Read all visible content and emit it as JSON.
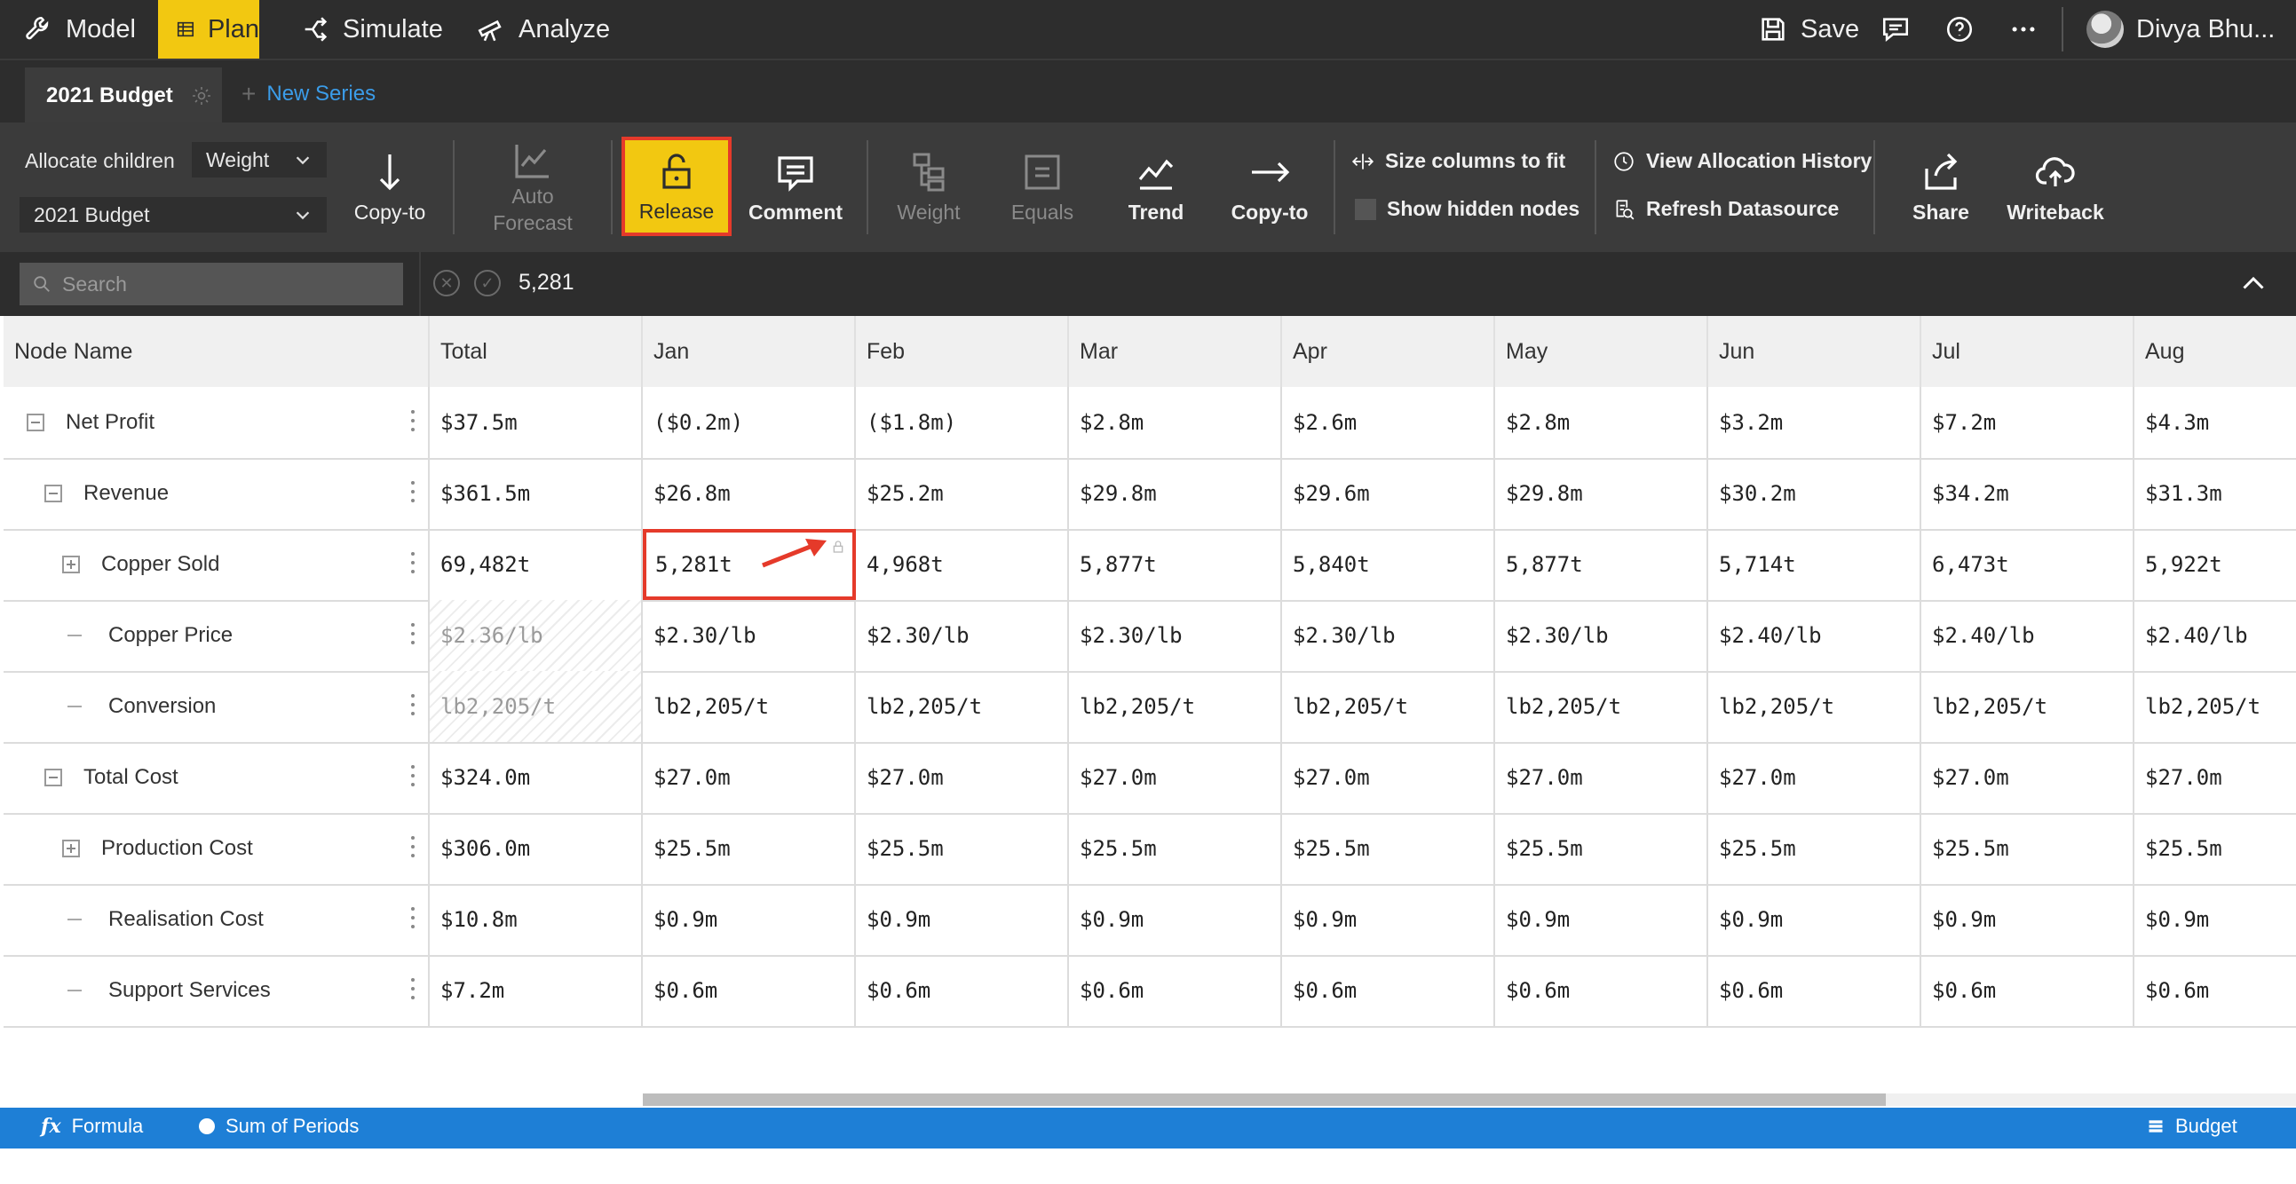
{
  "nav": {
    "model": "Model",
    "plan": "Plan",
    "simulate": "Simulate",
    "analyze": "Analyze",
    "save": "Save",
    "user": "Divya Bhu..."
  },
  "tabs": {
    "active": "2021 Budget",
    "new_series": "New Series"
  },
  "ribbon": {
    "allocate_children": "Allocate children",
    "weight_dropdown": "Weight",
    "series_dropdown": "2021 Budget",
    "copy_to_1": "Copy-to",
    "auto_forecast_1": "Auto",
    "auto_forecast_2": "Forecast",
    "release": "Release",
    "comment": "Comment",
    "weight": "Weight",
    "equals": "Equals",
    "trend": "Trend",
    "copy_to_2": "Copy-to",
    "size_columns": "Size columns to fit",
    "show_hidden": "Show hidden nodes",
    "view_history": "View Allocation History",
    "refresh": "Refresh Datasource",
    "share": "Share",
    "writeback": "Writeback"
  },
  "search": {
    "placeholder": "Search",
    "formula_value": "5,281"
  },
  "grid": {
    "headers": [
      "Node Name",
      "Total",
      "Jan",
      "Feb",
      "Mar",
      "Apr",
      "May",
      "Jun",
      "Jul",
      "Aug"
    ],
    "rows": [
      {
        "name": "Net Profit",
        "values": [
          "$37.5m",
          "($0.2m)",
          "($1.8m)",
          "$2.8m",
          "$2.6m",
          "$2.8m",
          "$3.2m",
          "$7.2m",
          "$4.3m"
        ]
      },
      {
        "name": "Revenue",
        "values": [
          "$361.5m",
          "$26.8m",
          "$25.2m",
          "$29.8m",
          "$29.6m",
          "$29.8m",
          "$30.2m",
          "$34.2m",
          "$31.3m"
        ]
      },
      {
        "name": "Copper Sold",
        "values": [
          "69,482t",
          "5,281t",
          "4,968t",
          "5,877t",
          "5,840t",
          "5,877t",
          "5,714t",
          "6,473t",
          "5,922t"
        ]
      },
      {
        "name": "Copper Price",
        "values": [
          "$2.36/lb",
          "$2.30/lb",
          "$2.30/lb",
          "$2.30/lb",
          "$2.30/lb",
          "$2.30/lb",
          "$2.40/lb",
          "$2.40/lb",
          "$2.40/lb"
        ]
      },
      {
        "name": "Conversion",
        "values": [
          "lb2,205/t",
          "lb2,205/t",
          "lb2,205/t",
          "lb2,205/t",
          "lb2,205/t",
          "lb2,205/t",
          "lb2,205/t",
          "lb2,205/t",
          "lb2,205/t"
        ]
      },
      {
        "name": "Total Cost",
        "values": [
          "$324.0m",
          "$27.0m",
          "$27.0m",
          "$27.0m",
          "$27.0m",
          "$27.0m",
          "$27.0m",
          "$27.0m",
          "$27.0m"
        ]
      },
      {
        "name": "Production Cost",
        "values": [
          "$306.0m",
          "$25.5m",
          "$25.5m",
          "$25.5m",
          "$25.5m",
          "$25.5m",
          "$25.5m",
          "$25.5m",
          "$25.5m"
        ]
      },
      {
        "name": "Realisation Cost",
        "values": [
          "$10.8m",
          "$0.9m",
          "$0.9m",
          "$0.9m",
          "$0.9m",
          "$0.9m",
          "$0.9m",
          "$0.9m",
          "$0.9m"
        ]
      },
      {
        "name": "Support Services",
        "values": [
          "$7.2m",
          "$0.6m",
          "$0.6m",
          "$0.6m",
          "$0.6m",
          "$0.6m",
          "$0.6m",
          "$0.6m",
          "$0.6m"
        ]
      }
    ]
  },
  "status": {
    "formula": "Formula",
    "sum_of_periods": "Sum of Periods",
    "budget": "Budget"
  },
  "colors": {
    "accent": "#f2c811",
    "highlight": "#e53a2a",
    "statusbar": "#1e7fd6",
    "nav_bg": "#2d2d2d",
    "ribbon_bg": "#3b3b3b"
  }
}
